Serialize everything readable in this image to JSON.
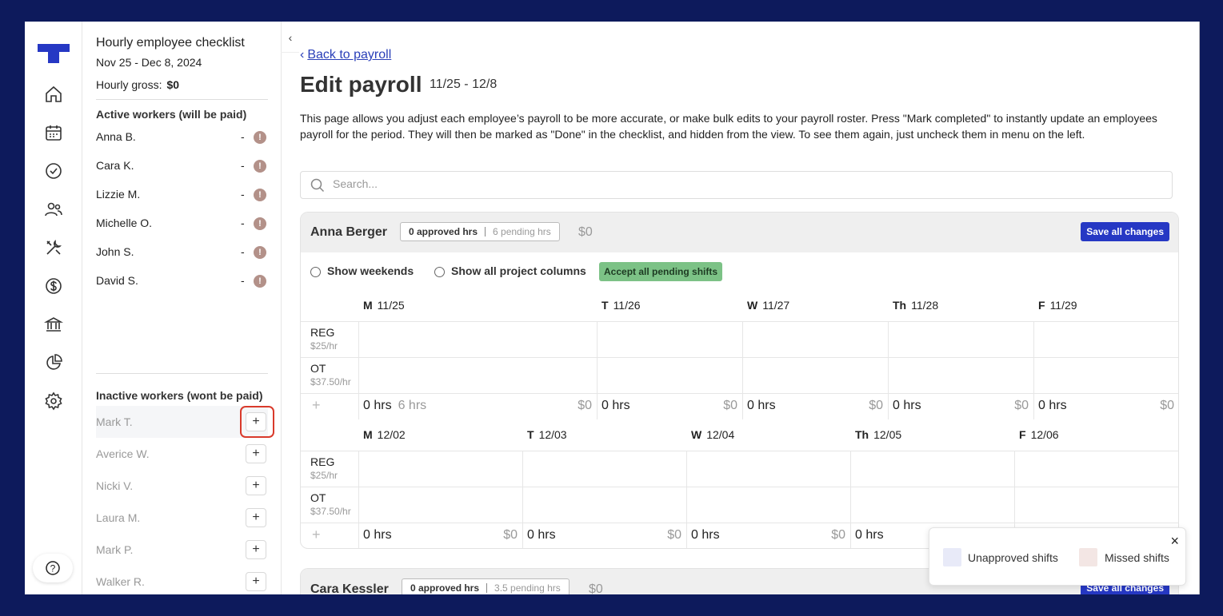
{
  "colors": {
    "accent": "#2638c4",
    "frame": "#0d1a5c",
    "warn": "#b39189",
    "accept": "#7cc286",
    "highlight_box": "#d93a2b",
    "unapproved": "#e8eaf8",
    "missed": "#f3e6e4"
  },
  "rail": {
    "icons": [
      "home-icon",
      "calendar-icon",
      "check-circle-icon",
      "users-icon",
      "tools-icon",
      "dollar-icon",
      "bank-icon",
      "pie-chart-icon",
      "gear-icon"
    ],
    "help": "?"
  },
  "panel": {
    "title": "Hourly employee checklist",
    "date_range": "Nov 25 - Dec 8, 2024",
    "gross_label": "Hourly gross:",
    "gross_value": "$0",
    "active_heading": "Active workers (will be paid)",
    "active_workers": [
      {
        "name": "Anna B.",
        "status": "-"
      },
      {
        "name": "Cara K.",
        "status": "-"
      },
      {
        "name": "Lizzie M.",
        "status": "-"
      },
      {
        "name": "Michelle O.",
        "status": "-"
      },
      {
        "name": "John S.",
        "status": "-"
      },
      {
        "name": "David S.",
        "status": "-"
      }
    ],
    "inactive_heading": "Inactive workers (wont be paid)",
    "inactive_workers": [
      {
        "name": "Mark T."
      },
      {
        "name": "Averice W."
      },
      {
        "name": "Nicki V."
      },
      {
        "name": "Laura M."
      },
      {
        "name": "Mark P."
      },
      {
        "name": "Walker R."
      }
    ],
    "add_label": "+",
    "collapse_label": "‹"
  },
  "main": {
    "back_label": "Back to payroll",
    "title": "Edit payroll",
    "title_range": "11/25 - 12/8",
    "description": "This page allows you adjust each employee’s payroll to be more accurate, or make bulk edits to your payroll roster. Press \"Mark completed\" to instantly update an employees payroll for the period. They will then be marked as \"Done\" in the checklist, and hidden from the view. To see them again, just uncheck them in menu on the left.",
    "search_placeholder": "Search...",
    "show_weekends": "Show weekends",
    "show_projects": "Show all project columns",
    "accept_pending": "Accept all pending shifts",
    "save_label": "Save all changes",
    "reg_label": "REG",
    "reg_rate": "$25/hr",
    "ot_label": "OT",
    "ot_rate": "$37.50/hr",
    "row_add": "+",
    "cards": [
      {
        "name": "Anna Berger",
        "approved": "0 approved hrs",
        "pending": "6 pending hrs",
        "total": "$0",
        "weeks": [
          {
            "days": [
              {
                "dow": "M",
                "date": "11/25",
                "hrs": "0 hrs",
                "pending": "6 hrs",
                "amount": "$0"
              },
              {
                "dow": "T",
                "date": "11/26",
                "hrs": "0 hrs",
                "pending": "",
                "amount": "$0"
              },
              {
                "dow": "W",
                "date": "11/27",
                "hrs": "0 hrs",
                "pending": "",
                "amount": "$0"
              },
              {
                "dow": "Th",
                "date": "11/28",
                "hrs": "0 hrs",
                "pending": "",
                "amount": "$0"
              },
              {
                "dow": "F",
                "date": "11/29",
                "hrs": "0 hrs",
                "pending": "",
                "amount": "$0"
              }
            ]
          },
          {
            "days": [
              {
                "dow": "M",
                "date": "12/02",
                "hrs": "0 hrs",
                "pending": "",
                "amount": "$0"
              },
              {
                "dow": "T",
                "date": "12/03",
                "hrs": "0 hrs",
                "pending": "",
                "amount": "$0"
              },
              {
                "dow": "W",
                "date": "12/04",
                "hrs": "0 hrs",
                "pending": "",
                "amount": "$0"
              },
              {
                "dow": "Th",
                "date": "12/05",
                "hrs": "0 hrs",
                "pending": "",
                "amount": ""
              },
              {
                "dow": "F",
                "date": "12/06",
                "hrs": "",
                "pending": "",
                "amount": ""
              }
            ]
          }
        ]
      },
      {
        "name": "Cara Kessler",
        "approved": "0 approved hrs",
        "pending": "3.5 pending hrs",
        "total": "$0"
      }
    ]
  },
  "legend": {
    "unapproved": "Unapproved shifts",
    "missed": "Missed shifts",
    "close": "×"
  }
}
